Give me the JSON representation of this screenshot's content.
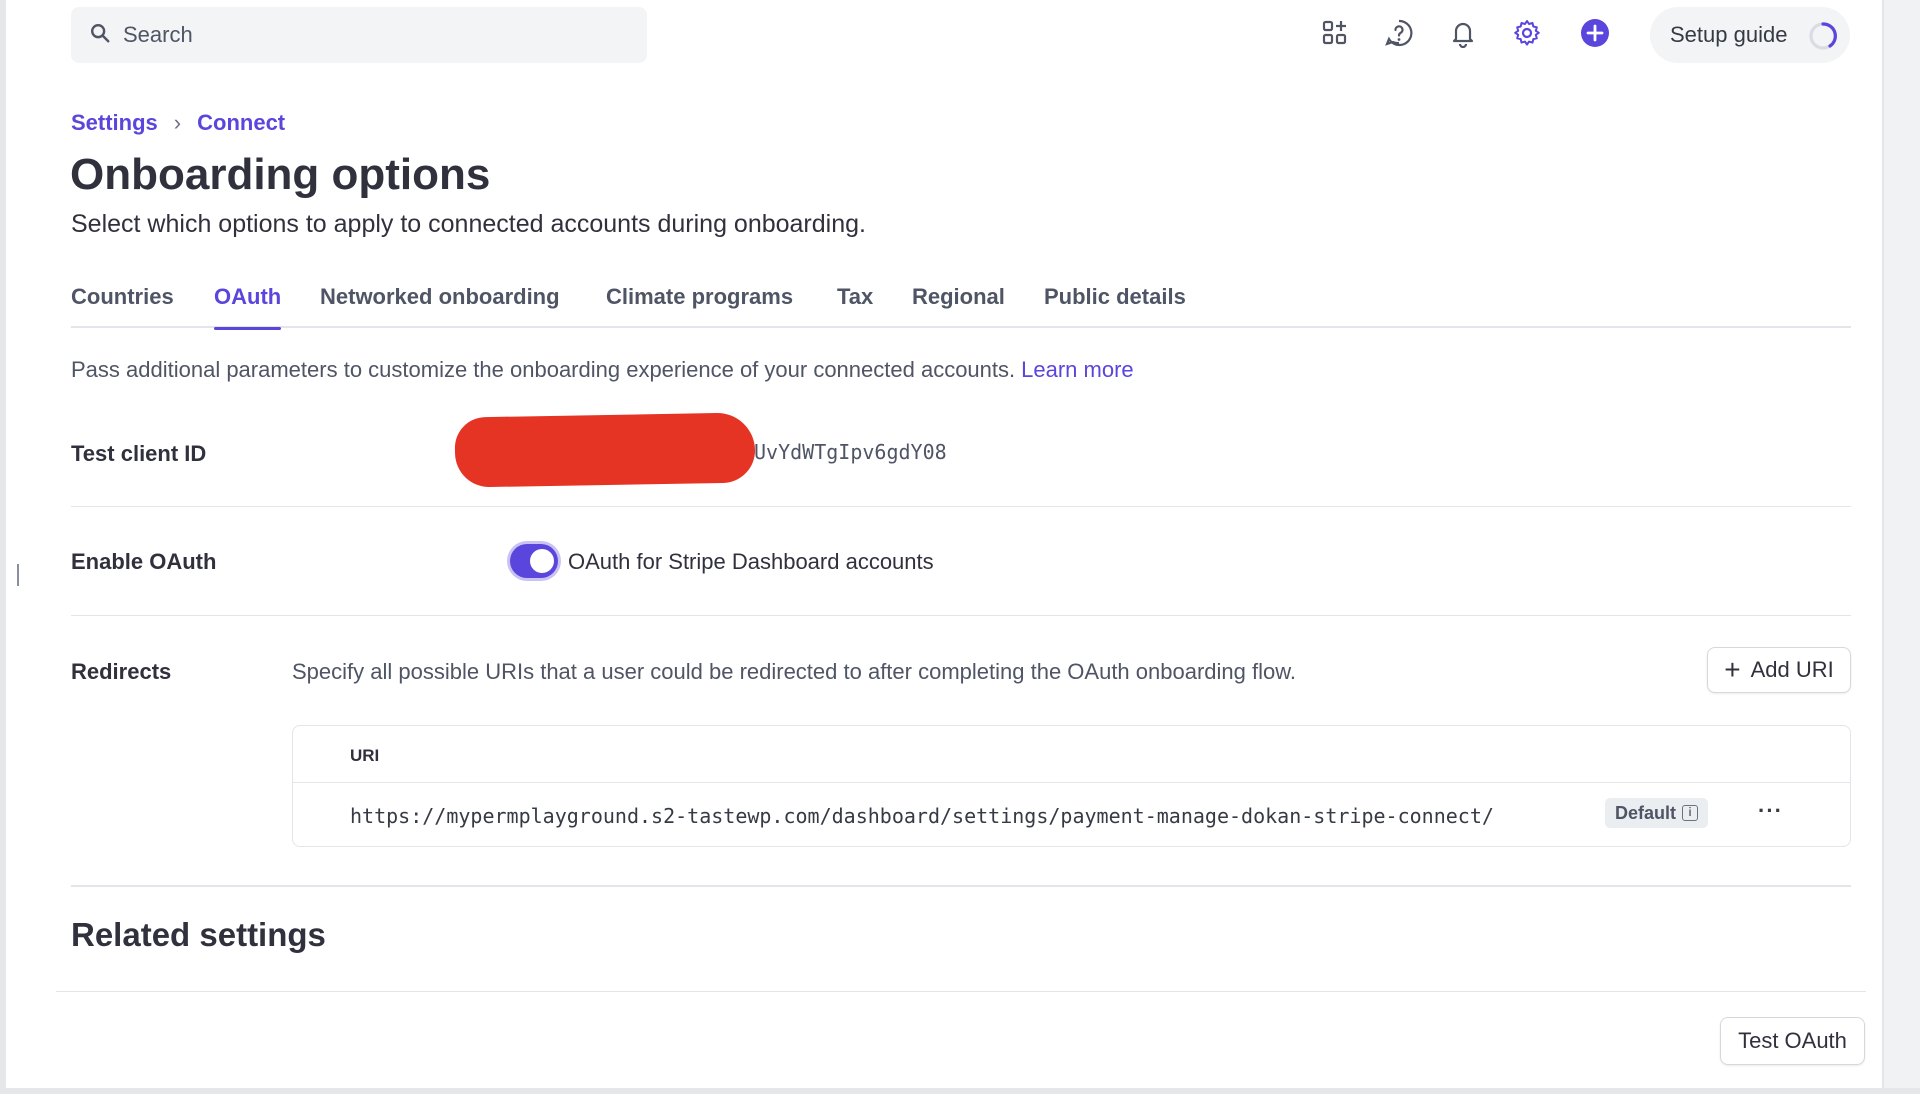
{
  "topbar": {
    "search_placeholder": "Search",
    "icons": [
      "apps-icon",
      "help-icon",
      "bell-icon",
      "gear-icon",
      "plus-icon"
    ],
    "setup_guide_label": "Setup guide",
    "accent_color": "#5a45dd"
  },
  "breadcrumb": {
    "items": [
      "Settings",
      "Connect"
    ]
  },
  "header": {
    "title": "Onboarding options",
    "subtitle": "Select which options to apply to connected accounts during onboarding."
  },
  "tabs": [
    {
      "label": "Countries",
      "active": false
    },
    {
      "label": "OAuth",
      "active": true
    },
    {
      "label": "Networked onboarding",
      "active": false
    },
    {
      "label": "Climate programs",
      "active": false
    },
    {
      "label": "Tax",
      "active": false
    },
    {
      "label": "Regional",
      "active": false
    },
    {
      "label": "Public details",
      "active": false
    }
  ],
  "oauth": {
    "intro": "Pass additional parameters to customize the onboarding experience of your connected accounts.",
    "learn_more": "Learn more",
    "test_client_id_label": "Test client ID",
    "test_client_id_visible": "UvYdWTgIpv6gdY08",
    "enable_oauth_label": "Enable OAuth",
    "enable_oauth_toggle_on": true,
    "enable_oauth_text": "OAuth for Stripe Dashboard accounts",
    "redirects_label": "Redirects",
    "redirects_description": "Specify all possible URIs that a user could be redirected to after completing the OAuth onboarding flow.",
    "add_uri_label": "Add URI",
    "table": {
      "column_header": "URI",
      "rows": [
        {
          "uri": "https://mypermplayground.s2-tastewp.com/dashboard/settings/payment-manage-dokan-stripe-connect/",
          "badge": "Default"
        }
      ]
    }
  },
  "related_settings_title": "Related settings",
  "test_oauth_label": "Test OAuth"
}
